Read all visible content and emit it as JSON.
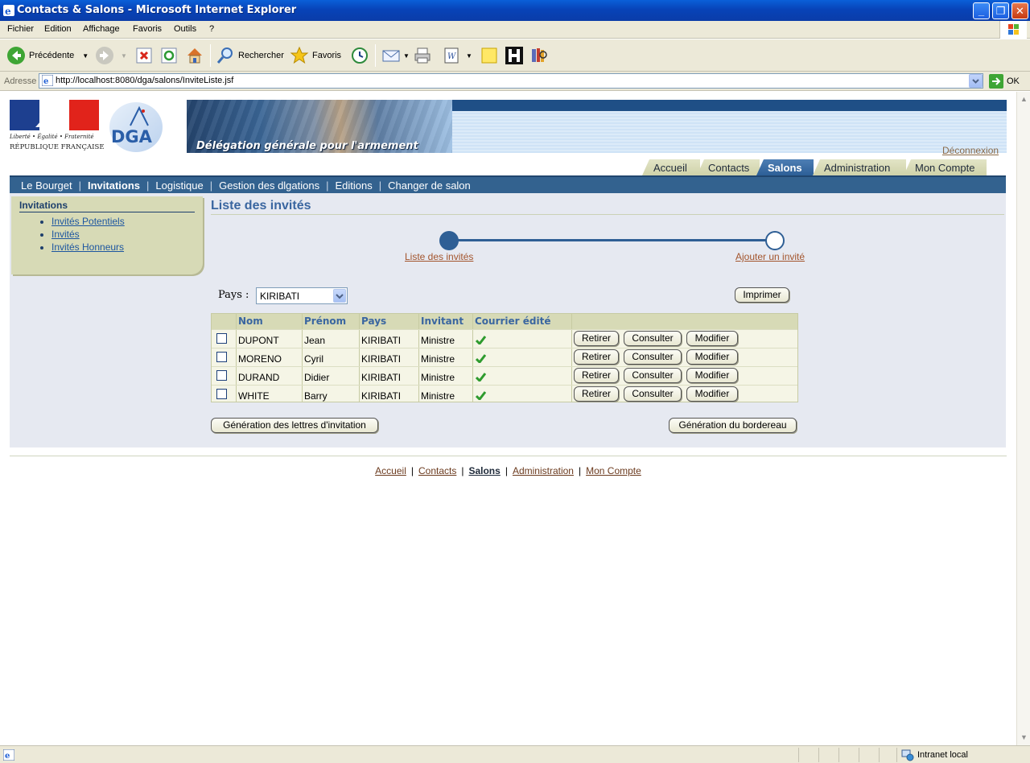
{
  "window": {
    "title": "Contacts & Salons - Microsoft Internet Explorer"
  },
  "menu": [
    "Fichier",
    "Edition",
    "Affichage",
    "Favoris",
    "Outils",
    "?"
  ],
  "toolbar": {
    "back": "Précédente",
    "search": "Rechercher",
    "favorites": "Favoris"
  },
  "address": {
    "label": "Adresse",
    "url": "http://localhost:8080/dga/salons/InviteListe.jsf",
    "go": "OK"
  },
  "status": {
    "zone": "Intranet local"
  },
  "banner": {
    "motto": "Liberté • Égalité • Fraternité",
    "republic": "RÉPUBLIQUE FRANÇAISE",
    "dga": "DGA",
    "caption": "Délégation générale pour l'armement"
  },
  "logout": "Déconnexion",
  "tabs": [
    "Accueil",
    "Contacts",
    "Salons",
    "Administration",
    "Mon Compte"
  ],
  "active_tab": "Salons",
  "subnav": [
    "Le Bourget",
    "Invitations",
    "Logistique",
    "Gestion des dlgations",
    "Editions",
    "Changer de salon"
  ],
  "active_subnav": "Invitations",
  "sidebar": {
    "title": "Invitations",
    "items": [
      "Invités Potentiels",
      "Invités",
      "Invités Honneurs"
    ]
  },
  "page_title": "Liste des invités",
  "train": {
    "step1": "Liste des invités",
    "step2": "Ajouter un invité"
  },
  "filter": {
    "label": "Pays :",
    "value": "KIRIBATI"
  },
  "print_button": "Imprimer",
  "table": {
    "columns": [
      "Nom",
      "Prénom",
      "Pays",
      "Invitant",
      "Courrier édité"
    ],
    "rows": [
      {
        "nom": "DUPONT",
        "prenom": "Jean",
        "pays": "KIRIBATI",
        "invitant": "Ministre",
        "courrier": true
      },
      {
        "nom": "MORENO",
        "prenom": "Cyril",
        "pays": "KIRIBATI",
        "invitant": "Ministre",
        "courrier": true
      },
      {
        "nom": "DURAND",
        "prenom": "Didier",
        "pays": "KIRIBATI",
        "invitant": "Ministre",
        "courrier": true
      },
      {
        "nom": "WHITE",
        "prenom": "Barry",
        "pays": "KIRIBATI",
        "invitant": "Ministre",
        "courrier": true
      }
    ],
    "actions": [
      "Retirer",
      "Consulter",
      "Modifier"
    ]
  },
  "bottom_buttons": {
    "letters": "Génération des lettres d'invitation",
    "bordereau": "Génération du bordereau"
  },
  "footer": [
    "Accueil",
    "Contacts",
    "Salons",
    "Administration",
    "Mon Compte"
  ],
  "active_footer": "Salons",
  "colors": {
    "nav_blue": "#33628f",
    "khaki": "#d7dab6",
    "title_blue": "#3a66a0",
    "link_brown": "#a3552d"
  }
}
